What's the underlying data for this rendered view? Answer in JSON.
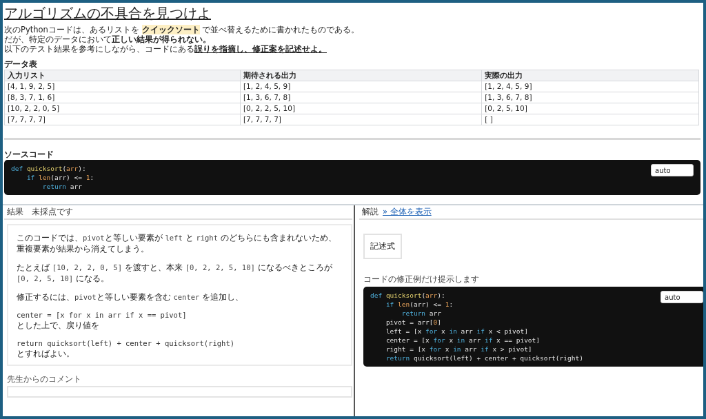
{
  "title": "アルゴリズムの不具合を見つけよ",
  "intro": [
    [
      {
        "kind": "plain",
        "text": "次のPythonコードは、あるリストを "
      },
      {
        "kind": "highlight",
        "text": "クイックソート"
      },
      {
        "kind": "plain",
        "text": " で並べ替えるために書かれたものである。"
      }
    ],
    [
      {
        "kind": "plain",
        "text": "だが、特定のデータにおいて"
      },
      {
        "kind": "bold",
        "text": "正しい結果が得られない。"
      }
    ],
    [
      {
        "kind": "plain",
        "text": "以下のテスト結果を参考にしながら、コードにある"
      },
      {
        "kind": "underline",
        "text": "誤りを指摘し、修正案を記述せよ。"
      }
    ]
  ],
  "data_table": {
    "caption": "データ表",
    "columns": [
      "入力リスト",
      "期待される出力",
      "実際の出力"
    ],
    "rows": [
      [
        "[4, 1, 9, 2, 5]",
        "[1, 2, 4, 5, 9]",
        "[1, 2, 4, 5, 9]"
      ],
      [
        "[8, 3, 7, 1, 6]",
        "[1, 3, 6, 7, 8]",
        "[1, 3, 6, 7, 8]"
      ],
      [
        "[10, 2, 2, 0, 5]",
        "[0, 2, 2, 5, 10]",
        "[0, 2, 5, 10]"
      ],
      [
        "[7, 7, 7, 7]",
        "[7, 7, 7, 7]",
        "[ ]"
      ]
    ]
  },
  "source": {
    "caption": "ソースコード",
    "language": "auto",
    "lines": [
      [
        {
          "kind": "keyword",
          "text": "def "
        },
        {
          "kind": "function",
          "text": "quicksort"
        },
        {
          "kind": "plain",
          "text": "("
        },
        {
          "kind": "number",
          "text": "arr"
        },
        {
          "kind": "plain",
          "text": "):"
        }
      ],
      [
        {
          "kind": "keyword",
          "text": "    if "
        },
        {
          "kind": "number",
          "text": "len"
        },
        {
          "kind": "plain",
          "text": "(arr) <= "
        },
        {
          "kind": "number",
          "text": "1"
        },
        {
          "kind": "plain",
          "text": ":"
        }
      ],
      [
        {
          "kind": "keyword",
          "text": "        return "
        },
        {
          "kind": "plain",
          "text": "arr"
        }
      ]
    ]
  },
  "result_panel": {
    "header": "結果　未採点です",
    "blocks": [
      [
        {
          "kind": "para",
          "parts": [
            {
              "kind": "plain",
              "text": "このコードでは、"
            },
            {
              "kind": "code",
              "text": "pivot"
            },
            {
              "kind": "plain",
              "text": "と等しい要素が "
            },
            {
              "kind": "code",
              "text": "left"
            },
            {
              "kind": "plain",
              "text": " と "
            },
            {
              "kind": "code",
              "text": "right"
            },
            {
              "kind": "plain",
              "text": " のどちらにも含まれないため、重複要素が結果から消えてしまう。"
            }
          ]
        }
      ],
      [
        {
          "kind": "para",
          "parts": [
            {
              "kind": "plain",
              "text": "たとえば "
            },
            {
              "kind": "code",
              "text": "[10, 2, 2, 0, 5]"
            },
            {
              "kind": "plain",
              "text": " を渡すと、本来 "
            },
            {
              "kind": "code",
              "text": "[0, 2, 2, 5, 10]"
            },
            {
              "kind": "plain",
              "text": " になるべきところが "
            },
            {
              "kind": "code",
              "text": "[0, 2, 5, 10]"
            },
            {
              "kind": "plain",
              "text": " になる。"
            }
          ]
        }
      ],
      [
        {
          "kind": "para",
          "parts": [
            {
              "kind": "plain",
              "text": "修正するには、"
            },
            {
              "kind": "code",
              "text": "pivot"
            },
            {
              "kind": "plain",
              "text": "と等しい要素を含む "
            },
            {
              "kind": "code",
              "text": "center"
            },
            {
              "kind": "plain",
              "text": " を追加し、"
            }
          ]
        }
      ],
      [
        {
          "kind": "code",
          "text": "center = [x for x in arr if x == pivot]"
        },
        {
          "kind": "para",
          "parts": [
            {
              "kind": "plain",
              "text": "とした上で、戻り値を"
            }
          ]
        }
      ],
      [
        {
          "kind": "code",
          "text": "return quicksort(left) + center + quicksort(right)"
        },
        {
          "kind": "para",
          "parts": [
            {
              "kind": "plain",
              "text": "とすればよい。"
            }
          ]
        }
      ]
    ],
    "comment_label": "先生からのコメント"
  },
  "answer_panel": {
    "header": "解説",
    "show_all_link": "» 全体を表示",
    "answer_type": "記述式",
    "note": "コードの修正例だけ提示します",
    "language": "auto",
    "lines": [
      [
        {
          "kind": "keyword",
          "text": "def "
        },
        {
          "kind": "function",
          "text": "quicksort"
        },
        {
          "kind": "plain",
          "text": "("
        },
        {
          "kind": "number",
          "text": "arr"
        },
        {
          "kind": "plain",
          "text": "):"
        }
      ],
      [
        {
          "kind": "keyword",
          "text": "    if "
        },
        {
          "kind": "number",
          "text": "len"
        },
        {
          "kind": "plain",
          "text": "(arr) <= "
        },
        {
          "kind": "number",
          "text": "1"
        },
        {
          "kind": "plain",
          "text": ":"
        }
      ],
      [
        {
          "kind": "keyword",
          "text": "        return "
        },
        {
          "kind": "plain",
          "text": "arr"
        }
      ],
      [
        {
          "kind": "plain",
          "text": "    pivot = arr["
        },
        {
          "kind": "number",
          "text": "0"
        },
        {
          "kind": "plain",
          "text": "]"
        }
      ],
      [
        {
          "kind": "plain",
          "text": "    left = [x "
        },
        {
          "kind": "keyword",
          "text": "for"
        },
        {
          "kind": "plain",
          "text": " x "
        },
        {
          "kind": "keyword",
          "text": "in"
        },
        {
          "kind": "plain",
          "text": " arr "
        },
        {
          "kind": "keyword",
          "text": "if"
        },
        {
          "kind": "plain",
          "text": " x < pivot]"
        }
      ],
      [
        {
          "kind": "plain",
          "text": "    center = [x "
        },
        {
          "kind": "keyword",
          "text": "for"
        },
        {
          "kind": "plain",
          "text": " x "
        },
        {
          "kind": "keyword",
          "text": "in"
        },
        {
          "kind": "plain",
          "text": " arr "
        },
        {
          "kind": "keyword",
          "text": "if"
        },
        {
          "kind": "plain",
          "text": " x == pivot]"
        }
      ],
      [
        {
          "kind": "plain",
          "text": "    right = [x "
        },
        {
          "kind": "keyword",
          "text": "for"
        },
        {
          "kind": "plain",
          "text": " x "
        },
        {
          "kind": "keyword",
          "text": "in"
        },
        {
          "kind": "plain",
          "text": " arr "
        },
        {
          "kind": "keyword",
          "text": "if"
        },
        {
          "kind": "plain",
          "text": " x > pivot]"
        }
      ],
      [
        {
          "kind": "keyword",
          "text": "    return"
        },
        {
          "kind": "plain",
          "text": " quicksort(left) + center + quicksort(right)"
        }
      ]
    ]
  }
}
